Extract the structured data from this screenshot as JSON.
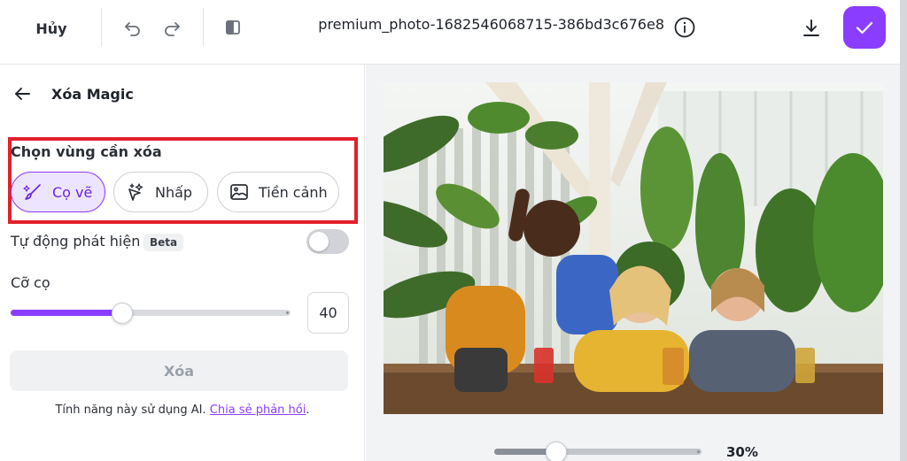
{
  "topbar": {
    "cancel_label": "Hủy",
    "filename": "premium_photo-1682546068715-386bd3c676e8",
    "icons": [
      "undo-icon",
      "redo-icon",
      "compare-icon",
      "info-icon",
      "download-icon",
      "check-icon"
    ]
  },
  "panel": {
    "title": "Xóa Magic",
    "select_label": "Chọn vùng cần xóa",
    "modes": [
      {
        "label": "Cọ vẽ",
        "icon": "brush-icon",
        "active": true
      },
      {
        "label": "Nhấp",
        "icon": "sparkle-cursor-icon",
        "active": false
      },
      {
        "label": "Tiền cảnh",
        "icon": "foreground-image-icon",
        "active": false
      }
    ],
    "auto_detect_label": "Tự động phát hiện",
    "beta_label": "Beta",
    "auto_detect_on": false,
    "brush_size_label": "Cỡ cọ",
    "brush_size_value": "40",
    "brush_size_fraction": 0.4,
    "erase_label": "Xóa",
    "ai_note": "Tính năng này sử dụng AI.",
    "feedback_link": "Chia sẻ phản hồi",
    "note_end": "."
  },
  "canvas": {
    "zoom_label": "30%",
    "zoom_fraction": 0.3
  },
  "colors": {
    "accent": "#8b3dff",
    "highlight": "#e3202a"
  }
}
